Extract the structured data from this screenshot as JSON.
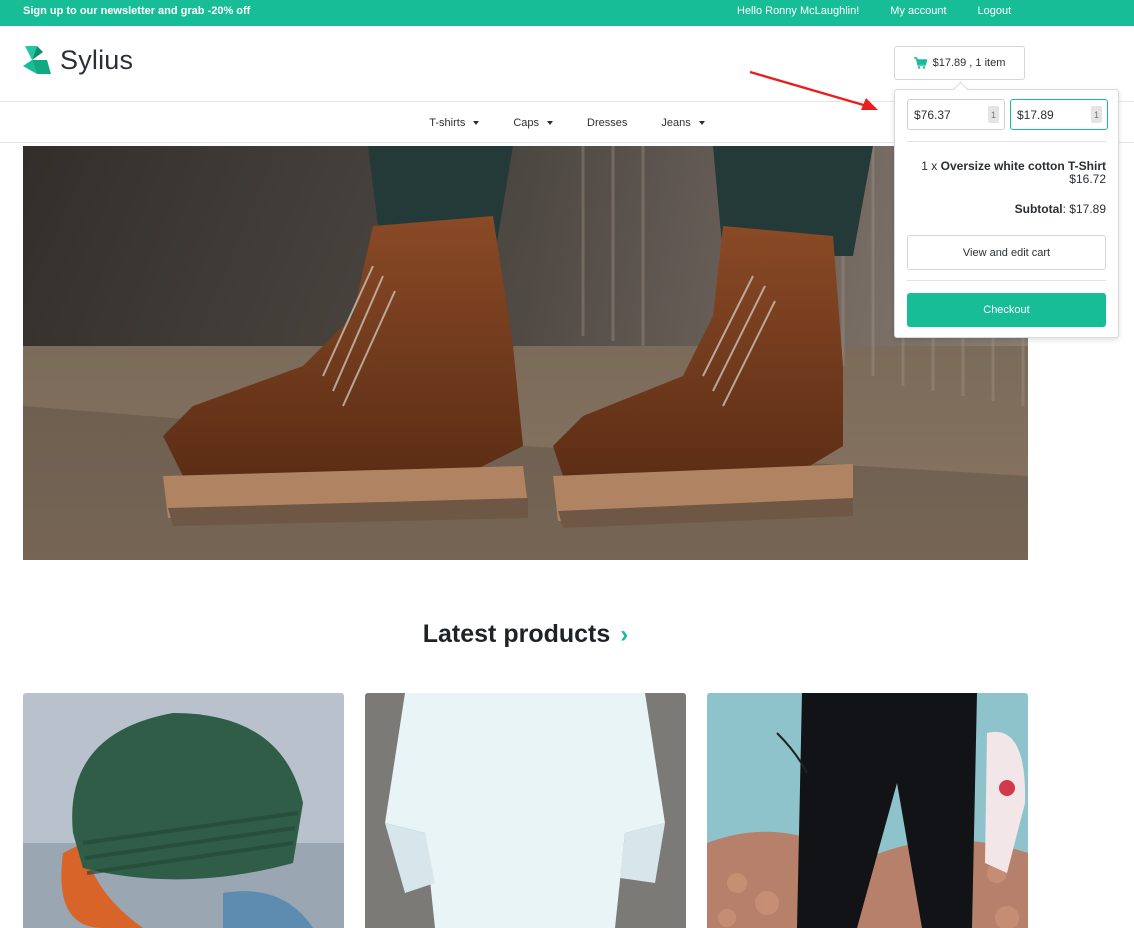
{
  "topbar": {
    "promo": "Sign up to our newsletter and grab -20% off",
    "greeting": "Hello Ronny McLaughlin!",
    "account": "My account",
    "logout": "Logout"
  },
  "header": {
    "logo_text": "Sylius",
    "cart_summary": "$17.89 , 1 item"
  },
  "nav": {
    "items": [
      {
        "label": "T-shirts",
        "dropdown": true
      },
      {
        "label": "Caps",
        "dropdown": true
      },
      {
        "label": "Dresses",
        "dropdown": false
      },
      {
        "label": "Jeans",
        "dropdown": true
      }
    ]
  },
  "cart_popup": {
    "price_fields": [
      {
        "value": "$76.37",
        "badge": "1"
      },
      {
        "value": "$17.89",
        "badge": "1"
      }
    ],
    "item_qty": "1 x",
    "item_name": "Oversize white cotton T-Shirt",
    "item_price": "$16.72",
    "subtotal_label": "Subtotal",
    "subtotal_value": "$17.89",
    "view_cart": "View and edit cart",
    "checkout": "Checkout"
  },
  "main": {
    "section_title": "Latest products"
  },
  "colors": {
    "brand": "#17bd96",
    "annotation_arrow": "#e8201c"
  }
}
